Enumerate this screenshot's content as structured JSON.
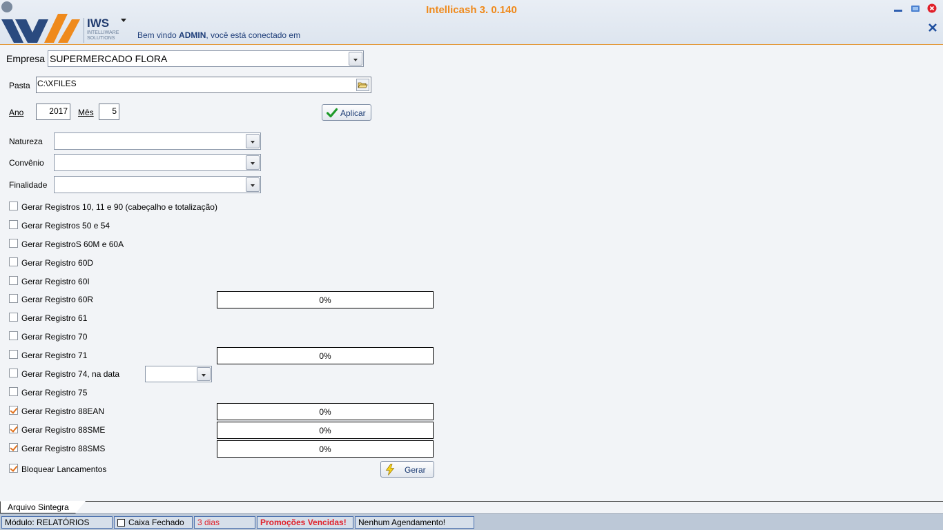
{
  "header": {
    "app_title": "Intellicash 3. 0.140",
    "brand": "IWS",
    "brand_sub_1": "INTELLIWARE",
    "brand_sub_2": "SOLUTIONS",
    "welcome_prefix": "Bem vindo ",
    "welcome_user": "ADMIN",
    "welcome_suffix": ", você está conectado em"
  },
  "form": {
    "empresa_label": "Empresa",
    "empresa_value": "SUPERMERCADO FLORA",
    "pasta_label": "Pasta",
    "pasta_value": "C:\\XFILES",
    "ano_label": "Ano",
    "ano_value": "2017",
    "mes_label": "Mês",
    "mes_value": "5",
    "aplicar_label": "Aplicar",
    "natureza_label": "Natureza",
    "natureza_value": "",
    "convenio_label": "Convênio",
    "convenio_value": "",
    "finalidade_label": "Finalidade",
    "finalidade_value": "",
    "na_data_value": "",
    "gerar_label": "Gerar"
  },
  "checkboxes": [
    {
      "label": "Gerar Registros 10, 11 e 90 (cabeçalho e totalização)",
      "checked": false
    },
    {
      "label": "Gerar Registros 50 e 54",
      "checked": false
    },
    {
      "label": "Gerar RegistroS 60M e 60A",
      "checked": false
    },
    {
      "label": "Gerar Registro 60D",
      "checked": false
    },
    {
      "label": "Gerar Registro 60I",
      "checked": false
    },
    {
      "label": "Gerar Registro 60R",
      "checked": false
    },
    {
      "label": "Gerar Registro 61",
      "checked": false
    },
    {
      "label": "Gerar Registro 70",
      "checked": false
    },
    {
      "label": "Gerar Registro 71",
      "checked": false
    },
    {
      "label": "Gerar Registro 74, na data",
      "checked": false
    },
    {
      "label": "Gerar Registro 75",
      "checked": false
    },
    {
      "label": "Gerar Registro 88EAN",
      "checked": true
    },
    {
      "label": "Gerar Registro 88SME",
      "checked": true
    },
    {
      "label": "Gerar Registro 88SMS",
      "checked": true
    },
    {
      "label": "Bloquear Lancamentos",
      "checked": true
    }
  ],
  "progress": {
    "r60r": {
      "label": "0%",
      "percent": 0
    },
    "r71": {
      "label": "0%",
      "percent": 0
    },
    "r88ean": {
      "label": "0%",
      "percent": 0
    },
    "r88sme": {
      "label": "0%",
      "percent": 0
    },
    "r88sms": {
      "label": "0%",
      "percent": 0
    }
  },
  "tabs": [
    {
      "label": "Arquivo Sintegra"
    }
  ],
  "status": {
    "modulo": "Módulo: RELATÓRIOS",
    "caixa": "Caixa Fechado",
    "dias": "3 dias",
    "promocoes": "Promoções Vencidas!",
    "agendamento": "Nenhum Agendamento!"
  },
  "colors": {
    "accent_orange": "#ef8a1c",
    "brand_blue": "#1f3a6e",
    "status_red": "#e0202a"
  }
}
